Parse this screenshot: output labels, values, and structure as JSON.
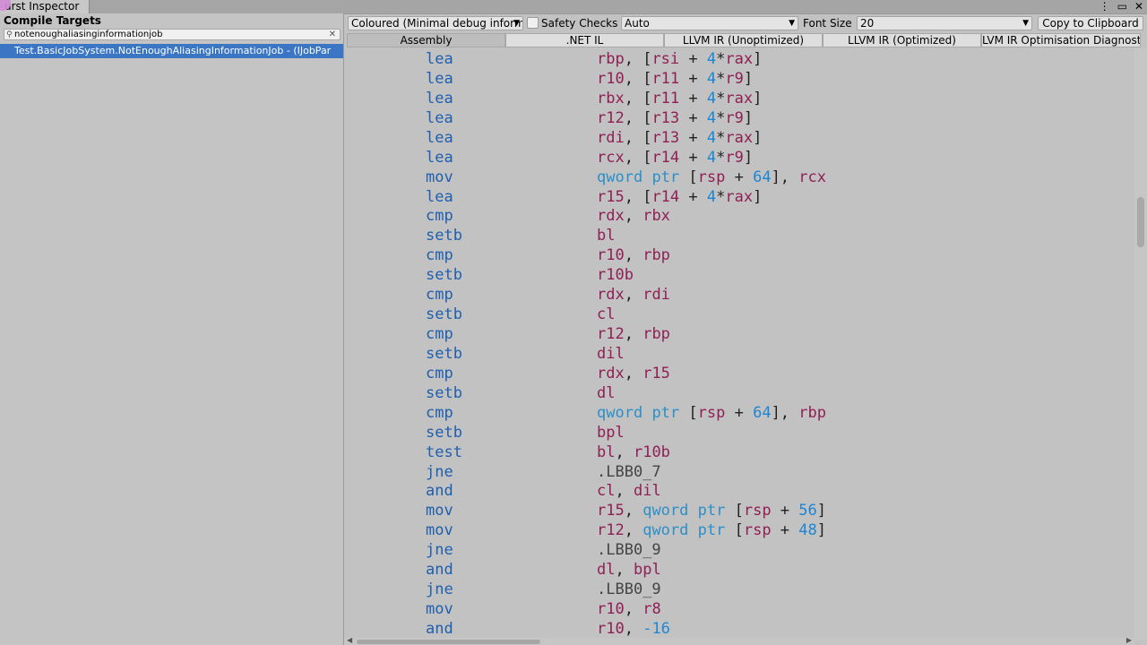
{
  "window": {
    "title": "urst Inspector",
    "controls": [
      "⋮",
      "▭",
      "✕"
    ]
  },
  "left_panel": {
    "header": "Compile Targets",
    "search": {
      "value": "notenoughaliasinginformationjob",
      "clear_glyph": "✕",
      "icon": "search-icon"
    },
    "targets": [
      "Test.BasicJobSystem.NotEnoughAliasingInformationJob - (IJobPar"
    ]
  },
  "toolbar": {
    "output_mode": "Coloured (Minimal debug informa",
    "safety_checks_label": "Safety Checks",
    "safety_checks_checked": false,
    "target_dropdown": "Auto",
    "font_size_label": "Font Size",
    "font_size_value": "20",
    "copy_button": "Copy to Clipboard"
  },
  "view_tabs": [
    {
      "label": "Assembly",
      "active": true
    },
    {
      "label": ".NET IL",
      "active": false
    },
    {
      "label": "LLVM IR (Unoptimized)",
      "active": false
    },
    {
      "label": "LLVM IR (Optimized)",
      "active": false
    },
    {
      "label": "LVM IR Optimisation Diagnostic",
      "active": false
    }
  ],
  "code_lines": [
    {
      "op": "lea",
      "args": "rbp, [rsi + 4*rax]"
    },
    {
      "op": "lea",
      "args": "r10, [r11 + 4*r9]"
    },
    {
      "op": "lea",
      "args": "rbx, [r11 + 4*rax]"
    },
    {
      "op": "lea",
      "args": "r12, [r13 + 4*r9]"
    },
    {
      "op": "lea",
      "args": "rdi, [r13 + 4*rax]"
    },
    {
      "op": "lea",
      "args": "rcx, [r14 + 4*r9]"
    },
    {
      "op": "mov",
      "args": "qword ptr [rsp + 64], rcx"
    },
    {
      "op": "lea",
      "args": "r15, [r14 + 4*rax]"
    },
    {
      "op": "cmp",
      "args": "rdx, rbx"
    },
    {
      "op": "setb",
      "args": "bl"
    },
    {
      "op": "cmp",
      "args": "r10, rbp"
    },
    {
      "op": "setb",
      "args": "r10b"
    },
    {
      "op": "cmp",
      "args": "rdx, rdi"
    },
    {
      "op": "setb",
      "args": "cl"
    },
    {
      "op": "cmp",
      "args": "r12, rbp"
    },
    {
      "op": "setb",
      "args": "dil"
    },
    {
      "op": "cmp",
      "args": "rdx, r15"
    },
    {
      "op": "setb",
      "args": "dl"
    },
    {
      "op": "cmp",
      "args": "qword ptr [rsp + 64], rbp"
    },
    {
      "op": "setb",
      "args": "bpl"
    },
    {
      "op": "test",
      "args": "bl, r10b"
    },
    {
      "op": "jne",
      "args": ".LBB0_7"
    },
    {
      "op": "and",
      "args": "cl, dil"
    },
    {
      "op": "mov",
      "args": "r15, qword ptr [rsp + 56]"
    },
    {
      "op": "mov",
      "args": "r12, qword ptr [rsp + 48]"
    },
    {
      "op": "jne",
      "args": ".LBB0_9"
    },
    {
      "op": "and",
      "args": "dl, bpl"
    },
    {
      "op": "jne",
      "args": ".LBB0_9"
    },
    {
      "op": "mov",
      "args": "r10, r8"
    },
    {
      "op": "and",
      "args": "r10, -16"
    }
  ],
  "colors": {
    "opcode": "#1f5fae",
    "register": "#8f1f55",
    "keyword": "#2b8fc8",
    "number": "#1c86d4",
    "selection": "#3a76c4"
  }
}
